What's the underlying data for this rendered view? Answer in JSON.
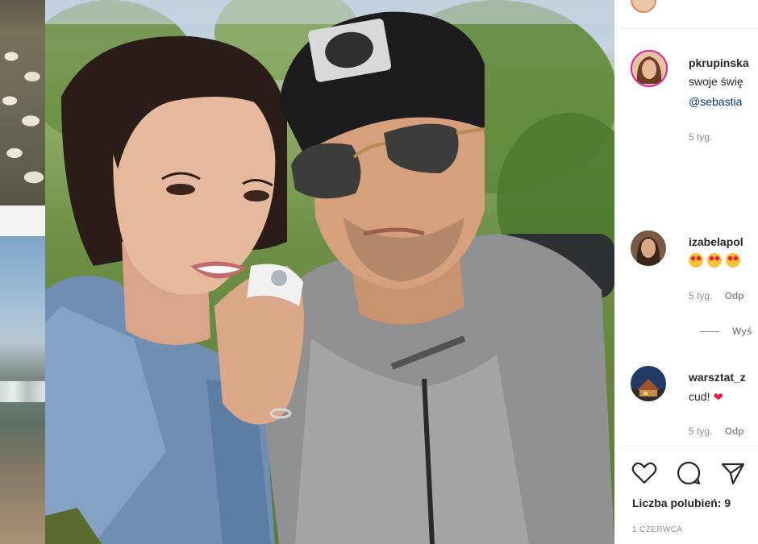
{
  "post": {
    "author_username": "pkrupinska",
    "caption_line": "swoje świę",
    "caption_mention": "@sebastia",
    "caption_time": "5 tyg."
  },
  "comments": [
    {
      "username": "izabelapol",
      "emoji_count": 3,
      "time": "5 tyg.",
      "reply_label": "Odp",
      "view_replies": "Wyś"
    },
    {
      "username": "warsztat_z",
      "text": "cud!",
      "heart": "❤",
      "time": "5 tyg.",
      "reply_label": "Odp"
    }
  ],
  "actions": {
    "like_icon": "heart-outline-icon",
    "comment_icon": "comment-bubble-icon",
    "share_icon": "paper-plane-icon"
  },
  "likes_text": "Liczba polubień: 9",
  "post_date": "1 CZERWCA",
  "colors": {
    "text_primary": "#262626",
    "text_secondary": "#8e8e8e",
    "link": "#00376b",
    "story_ring": "#d6249f",
    "border": "#efefef"
  }
}
